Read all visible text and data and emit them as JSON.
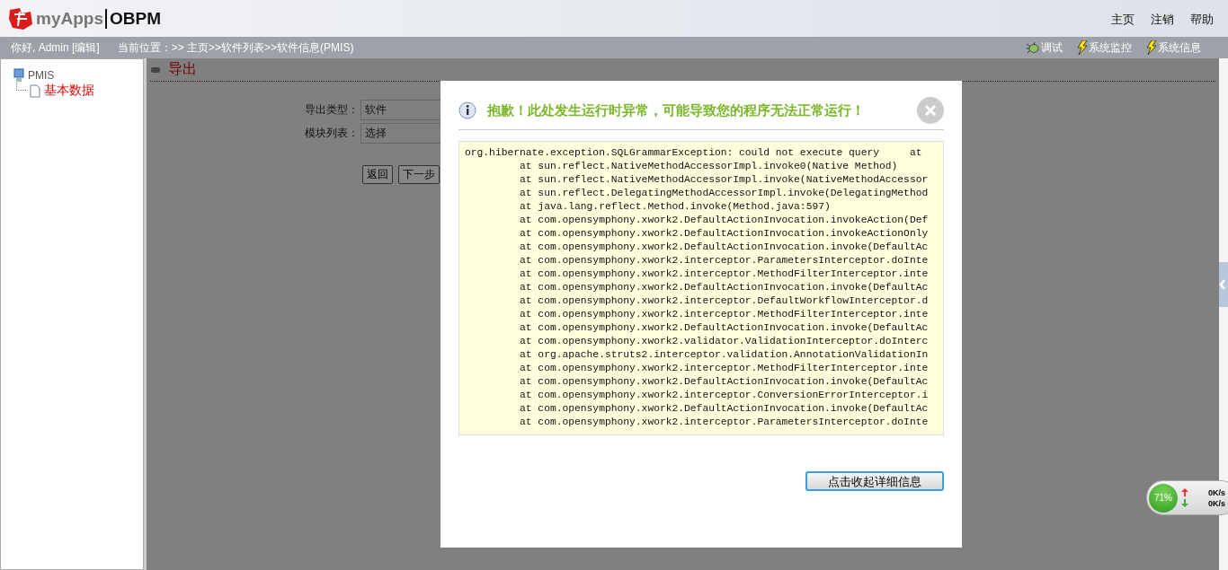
{
  "header": {
    "logo_brand": "myApps",
    "logo_product": "OBPM",
    "links": [
      "主页",
      "注销",
      "帮助"
    ]
  },
  "info_bar": {
    "greeting": "你好, Admin [编辑]",
    "location_label": "当前位置：",
    "breadcrumb": ">> 主页>>软件列表>>软件信息(PMIS)",
    "tools": [
      {
        "kind": "debug",
        "label": "调试"
      },
      {
        "kind": "bolt",
        "label": "系统监控"
      },
      {
        "kind": "bolt",
        "label": "系统信息"
      }
    ]
  },
  "tree": [
    {
      "label": "PMIS",
      "kind": "computer",
      "children": [
        {
          "label": "基本数据",
          "kind": "page",
          "selected": true
        }
      ]
    }
  ],
  "page": {
    "title": "导出",
    "fields": [
      {
        "label": "导出类型：",
        "value": "软件"
      },
      {
        "label": "模块列表：",
        "value": "选择"
      }
    ],
    "buttons": [
      "返回",
      "下一步"
    ]
  },
  "dialog": {
    "message": "抱歉！此处发生运行时异常，可能导致您的程序无法正常运行！",
    "trace": [
      "org.hibernate.exception.SQLGrammarException: could not execute query     at",
      "         at sun.reflect.NativeMethodAccessorImpl.invoke0(Native Method)",
      "         at sun.reflect.NativeMethodAccessorImpl.invoke(NativeMethodAccessor",
      "         at sun.reflect.DelegatingMethodAccessorImpl.invoke(DelegatingMethod",
      "         at java.lang.reflect.Method.invoke(Method.java:597)",
      "         at com.opensymphony.xwork2.DefaultActionInvocation.invokeAction(Def",
      "         at com.opensymphony.xwork2.DefaultActionInvocation.invokeActionOnly",
      "         at com.opensymphony.xwork2.DefaultActionInvocation.invoke(DefaultAc",
      "         at com.opensymphony.xwork2.interceptor.ParametersInterceptor.doInte",
      "         at com.opensymphony.xwork2.interceptor.MethodFilterInterceptor.inte",
      "         at com.opensymphony.xwork2.DefaultActionInvocation.invoke(DefaultAc",
      "         at com.opensymphony.xwork2.interceptor.DefaultWorkflowInterceptor.d",
      "         at com.opensymphony.xwork2.interceptor.MethodFilterInterceptor.inte",
      "         at com.opensymphony.xwork2.DefaultActionInvocation.invoke(DefaultAc",
      "         at com.opensymphony.xwork2.validator.ValidationInterceptor.doInterc",
      "         at org.apache.struts2.interceptor.validation.AnnotationValidationIn",
      "         at com.opensymphony.xwork2.interceptor.MethodFilterInterceptor.inte",
      "         at com.opensymphony.xwork2.DefaultActionInvocation.invoke(DefaultAc",
      "         at com.opensymphony.xwork2.interceptor.ConversionErrorInterceptor.i",
      "         at com.opensymphony.xwork2.DefaultActionInvocation.invoke(DefaultAc",
      "         at com.opensymphony.xwork2.interceptor.ParametersInterceptor.doInte"
    ],
    "button": "点击收起详细信息"
  },
  "net_widget": {
    "percent": "71%",
    "up": "0K/s",
    "down": "0K/s"
  }
}
